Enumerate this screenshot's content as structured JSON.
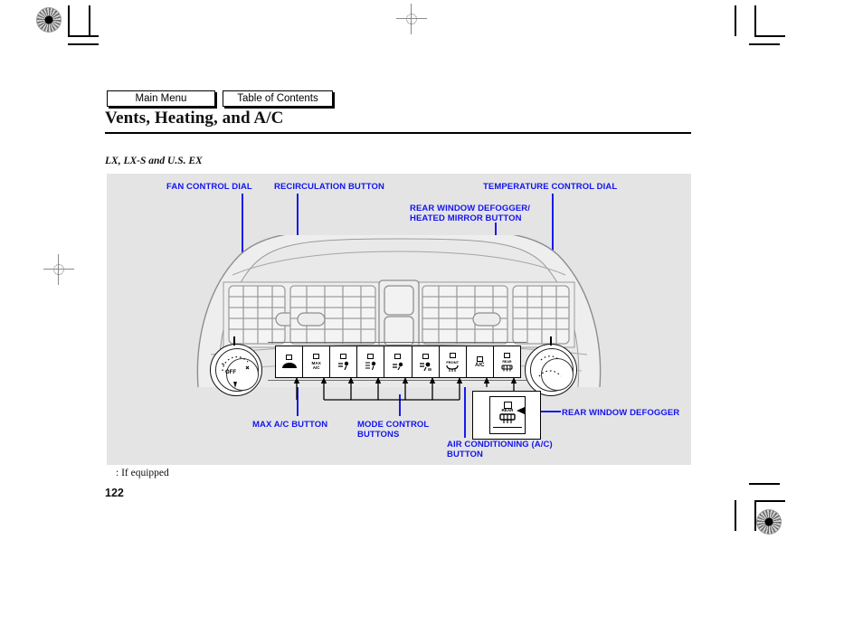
{
  "nav": {
    "main_menu": "Main Menu",
    "table_of_contents": "Table of Contents"
  },
  "header": {
    "title": "Vents, Heating, and A/C",
    "model_line": "LX, LX-S and U.S. EX"
  },
  "illustration": {
    "callouts": {
      "fan_control_dial": "FAN CONTROL DIAL",
      "recirculation_button": "RECIRCULATION BUTTON",
      "temperature_control_dial": "TEMPERATURE CONTROL DIAL",
      "rear_defogger_heated_mirror": "REAR WINDOW DEFOGGER/\nHEATED MIRROR   BUTTON",
      "max_ac_button": "MAX A/C BUTTON",
      "mode_control_buttons": "MODE CONTROL\nBUTTONS",
      "ac_button": "AIR CONDITIONING (A/C)\nBUTTON",
      "rear_window_defogger": "REAR WINDOW DEFOGGER"
    },
    "fan_dial": {
      "off_label": "OFF"
    },
    "buttons": [
      {
        "name": "recirculation",
        "glyph": "car"
      },
      {
        "name": "max-ac",
        "glyph": "MAX\nA/C"
      },
      {
        "name": "mode-face",
        "glyph": "mode"
      },
      {
        "name": "mode-face-foot",
        "glyph": "mode"
      },
      {
        "name": "mode-foot",
        "glyph": "mode"
      },
      {
        "name": "mode-foot-defrost",
        "glyph": "mode"
      },
      {
        "name": "front-defroster",
        "glyph": "FRONT"
      },
      {
        "name": "air-conditioning",
        "glyph": "A/C"
      },
      {
        "name": "rear-defogger",
        "glyph": "REAR"
      }
    ],
    "detail_glyph": "REAR"
  },
  "footer": {
    "footnote": ":  If equipped",
    "page_number": "122"
  },
  "colors": {
    "callout_blue": "#1414ef",
    "panel_grey": "#e4e4e4",
    "ink": "#000000"
  }
}
